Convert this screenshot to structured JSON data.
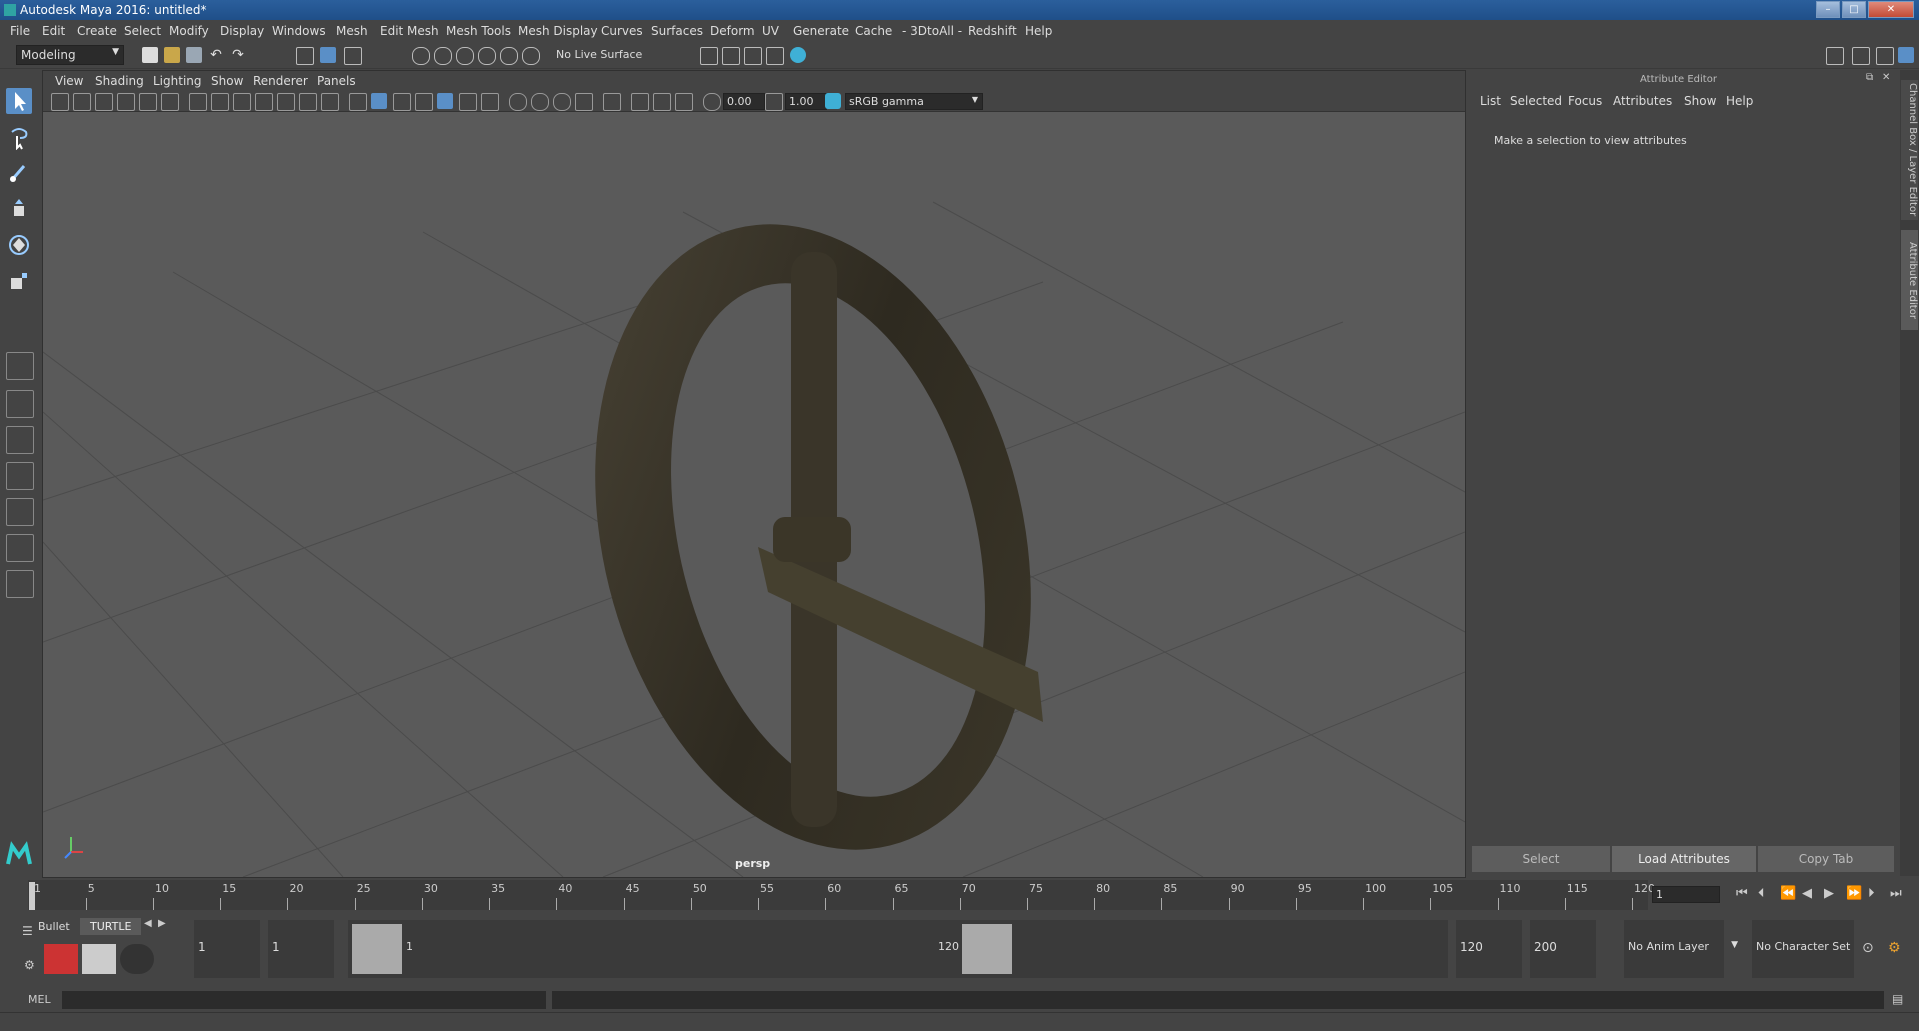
{
  "window": {
    "title": "Autodesk Maya 2016: untitled*"
  },
  "menubar": [
    "File",
    "Edit",
    "Create",
    "Select",
    "Modify",
    "Display",
    "Windows",
    "Mesh",
    "Edit Mesh",
    "Mesh Tools",
    "Mesh Display",
    "Curves",
    "Surfaces",
    "Deform",
    "UV",
    "Generate",
    "Cache",
    "- 3DtoAll -",
    "Redshift",
    "Help"
  ],
  "statusline": {
    "mode": "Modeling",
    "live_surface": "No Live Surface"
  },
  "viewport": {
    "menu": [
      "View",
      "Shading",
      "Lighting",
      "Show",
      "Renderer",
      "Panels"
    ],
    "exposure": "0.00",
    "gamma": "1.00",
    "color_space": "sRGB gamma",
    "camera_label": "persp"
  },
  "attribute_editor": {
    "header": "Attribute Editor",
    "menu": [
      "List",
      "Selected",
      "Focus",
      "Attributes",
      "Show",
      "Help"
    ],
    "message": "Make a selection to view attributes",
    "buttons": {
      "select": "Select",
      "load": "Load Attributes",
      "copy": "Copy Tab"
    }
  },
  "side_tabs": {
    "channel_box": "Channel Box / Layer Editor",
    "attribute_editor": "Attribute Editor"
  },
  "timeslider": {
    "ticks": [
      "1",
      "5",
      "10",
      "15",
      "20",
      "25",
      "30",
      "35",
      "40",
      "45",
      "50",
      "55",
      "60",
      "65",
      "70",
      "75",
      "80",
      "85",
      "90",
      "95",
      "100",
      "105",
      "110",
      "115",
      "120"
    ],
    "current_frame": "1"
  },
  "rangeslider": {
    "shelf_tabs": [
      "Bullet",
      "TURTLE"
    ],
    "start_anim": "1",
    "start_range": "1",
    "range_start_label": "1",
    "range_end_label": "120",
    "end_range": "120",
    "end_anim": "200",
    "anim_layer": "No Anim Layer",
    "character_set": "No Character Set"
  },
  "cmdline": {
    "label": "MEL"
  },
  "colors": {
    "accent": "#5a8fc7",
    "viewport_bg": "#5a5a5a",
    "grid": "#4a4a4a",
    "object": "#3a3325"
  }
}
